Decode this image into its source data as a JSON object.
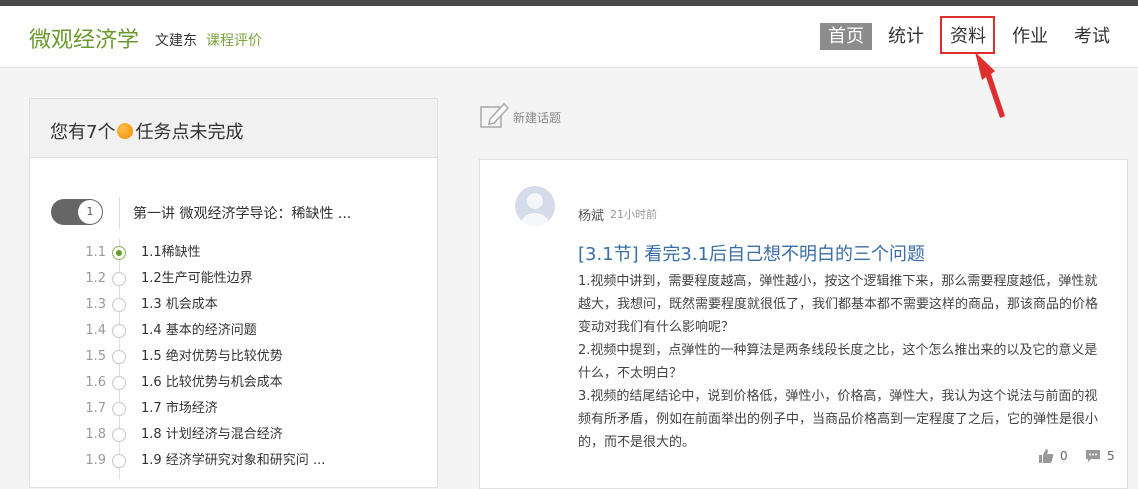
{
  "header": {
    "course_title": "微观经济学",
    "teacher": "文建东",
    "review_link": "课程评价",
    "nav": [
      "首页",
      "统计",
      "资料",
      "作业",
      "考试"
    ],
    "active_nav": "首页",
    "highlighted_nav": "资料"
  },
  "tasks": {
    "prefix": "您有7个",
    "suffix": "任务点未完成"
  },
  "chapter": {
    "number": "1",
    "title": "第一讲 微观经济学导论：稀缺性 ..."
  },
  "lessons": [
    {
      "num": "1.1",
      "title": "1.1稀缺性",
      "done": true
    },
    {
      "num": "1.2",
      "title": "1.2生产可能性边界",
      "done": false
    },
    {
      "num": "1.3",
      "title": "1.3 机会成本",
      "done": false
    },
    {
      "num": "1.4",
      "title": "1.4 基本的经济问题",
      "done": false
    },
    {
      "num": "1.5",
      "title": "1.5 绝对优势与比较优势",
      "done": false
    },
    {
      "num": "1.6",
      "title": "1.6 比较优势与机会成本",
      "done": false
    },
    {
      "num": "1.7",
      "title": "1.7 市场经济",
      "done": false
    },
    {
      "num": "1.8",
      "title": "1.8 计划经济与混合经济",
      "done": false
    },
    {
      "num": "1.9",
      "title": "1.9 经济学研究对象和研究问 ...",
      "done": false
    }
  ],
  "new_topic_label": "新建话题",
  "post": {
    "author": "杨斌",
    "time": "21小时前",
    "title": "[3.1节] 看完3.1后自己想不明白的三个问题",
    "paragraphs": [
      "1.视频中讲到，需要程度越高，弹性越小，按这个逻辑推下来，那么需要程度越低，弹性就越大，我想问，既然需要程度就很低了，我们都基本都不需要这样的商品，那该商品的价格变动对我们有什么影响呢？",
      "2.视频中提到，点弹性的一种算法是两条线段长度之比，这个怎么推出来的以及它的意义是什么，不太明白？",
      "3.视频的结尾结论中，说到价格低，弹性小，价格高，弹性大，我认为这个说法与前面的视频有所矛盾，例如在前面举出的例子中，当商品价格高到一定程度了之后，它的弹性是很小的，而不是很大的。"
    ],
    "likes": "0",
    "comments": "5"
  },
  "colors": {
    "brand_green": "#6a9a2d",
    "highlight_red": "#e02e2e",
    "link_blue": "#3a6ea5"
  }
}
